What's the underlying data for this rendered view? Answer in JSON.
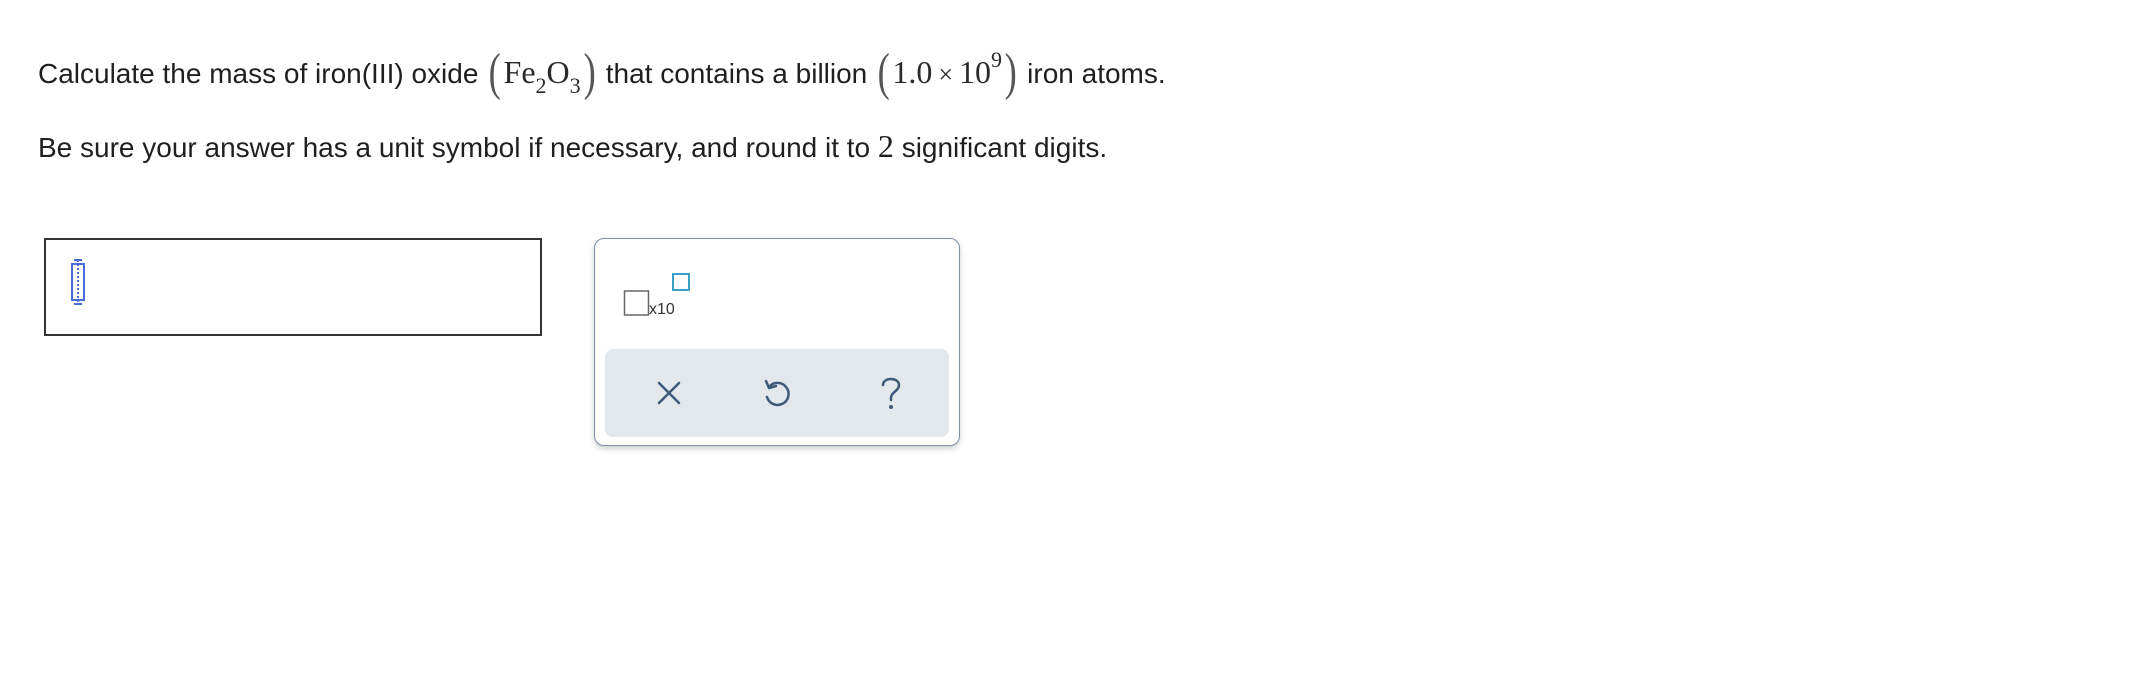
{
  "question": {
    "prefix": "Calculate the mass of iron(III) oxide",
    "formula": {
      "el1": "Fe",
      "sub1": "2",
      "el2": "O",
      "sub2": "3"
    },
    "middle": "that contains a billion",
    "quantity": {
      "mantissa": "1.0",
      "times": "×",
      "base": "10",
      "exponent": "9"
    },
    "suffix": "iron atoms."
  },
  "instruction": {
    "before": "Be sure your answer has a unit symbol if necessary, and round it to",
    "digits": "2",
    "after": "significant digits."
  },
  "palette": {
    "sci_label": "x10"
  },
  "icons": {
    "clear": "close-icon",
    "undo": "undo-icon",
    "help": "help-icon"
  },
  "colors": {
    "accent_blue": "#4a6cd6",
    "palette_border": "#7b8fa3",
    "action_bar": "#e3e8ec",
    "icon_color": "#3d5a78",
    "sci_exp_square": "#3aa0c8"
  }
}
